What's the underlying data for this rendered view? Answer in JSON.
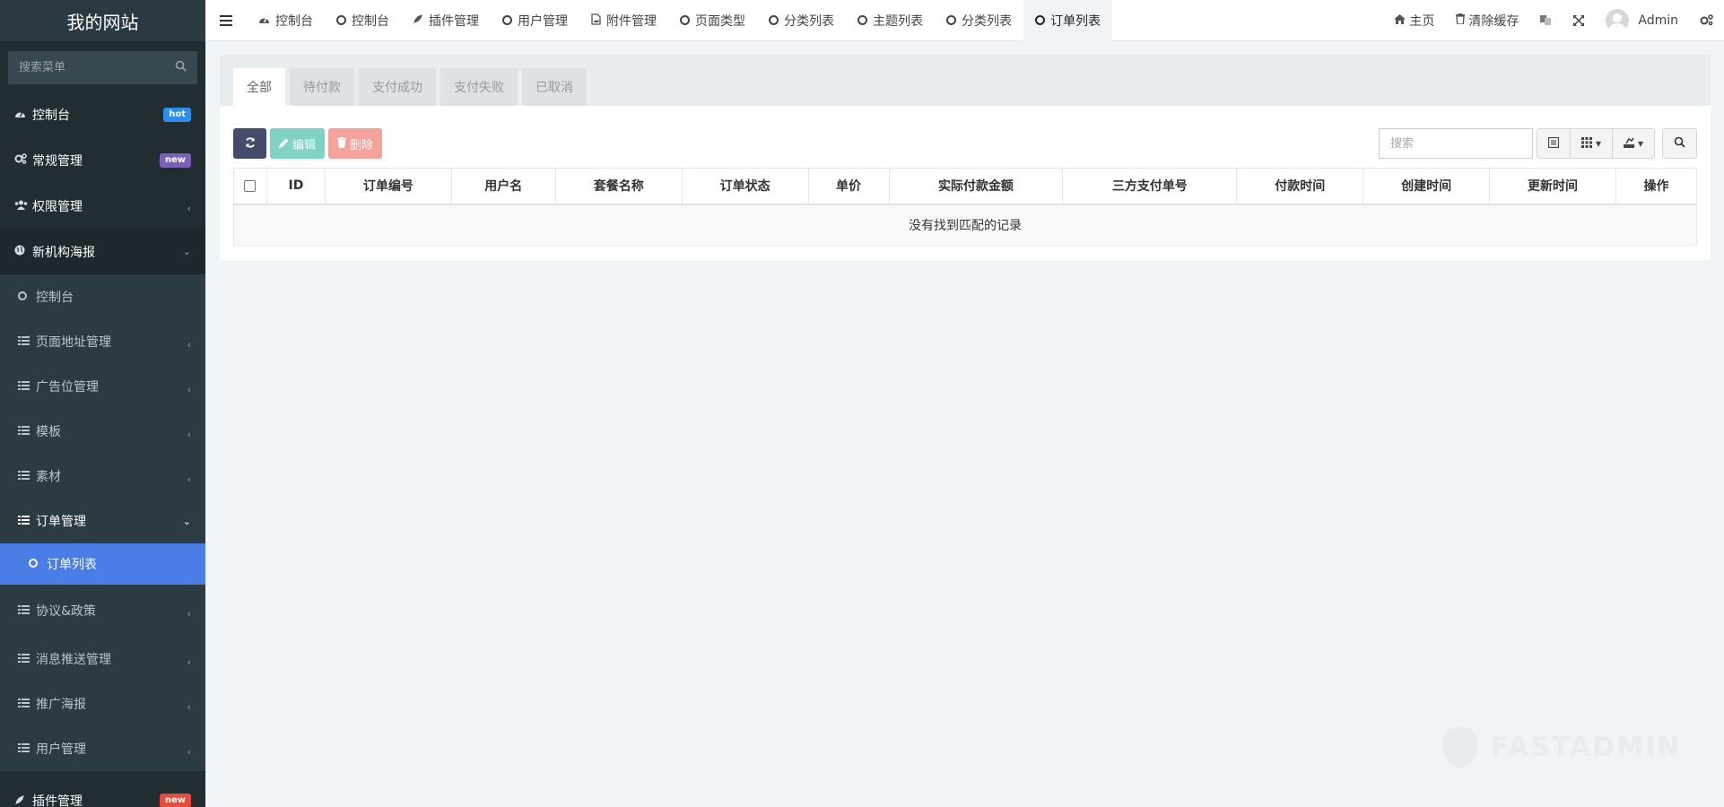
{
  "sidebar": {
    "logo": "我的网站",
    "search_placeholder": "搜索菜单",
    "items": [
      {
        "label": "控制台",
        "badge": "hot"
      },
      {
        "label": "常规管理",
        "badge": "new"
      },
      {
        "label": "权限管理"
      },
      {
        "label": "新机构海报"
      }
    ],
    "sub_items": [
      {
        "label": "控制台"
      },
      {
        "label": "页面地址管理"
      },
      {
        "label": "广告位管理"
      },
      {
        "label": "模板"
      },
      {
        "label": "素材"
      },
      {
        "label": "订单管理"
      },
      {
        "label": "订单列表"
      },
      {
        "label": "协议&政策"
      },
      {
        "label": "消息推送管理"
      },
      {
        "label": "推广海报"
      },
      {
        "label": "用户管理"
      }
    ],
    "last_item": {
      "label": "插件管理",
      "badge": "new"
    }
  },
  "topbar": {
    "tabs": [
      {
        "label": "控制台"
      },
      {
        "label": "控制台"
      },
      {
        "label": "插件管理"
      },
      {
        "label": "用户管理"
      },
      {
        "label": "附件管理"
      },
      {
        "label": "页面类型"
      },
      {
        "label": "分类列表"
      },
      {
        "label": "主题列表"
      },
      {
        "label": "分类列表"
      },
      {
        "label": "订单列表"
      }
    ],
    "home": "主页",
    "clear_cache": "清除缓存",
    "user": "Admin"
  },
  "panel": {
    "tabs": [
      "全部",
      "待付款",
      "支付成功",
      "支付失败",
      "已取消"
    ],
    "edit_label": "编辑",
    "delete_label": "删除",
    "search_placeholder": "搜索",
    "columns": [
      "ID",
      "订单编号",
      "用户名",
      "套餐名称",
      "订单状态",
      "单价",
      "实际付款金额",
      "三方支付单号",
      "付款时间",
      "创建时间",
      "更新时间",
      "操作"
    ],
    "empty_text": "没有找到匹配的记录"
  },
  "watermark": "FASTADMIN",
  "colors": {
    "sidebar_bg": "#222d32",
    "active_item": "#4b7de7",
    "refresh_btn": "#444c69",
    "edit_btn": "#7fd3c0",
    "delete_btn": "#f4a29a"
  }
}
